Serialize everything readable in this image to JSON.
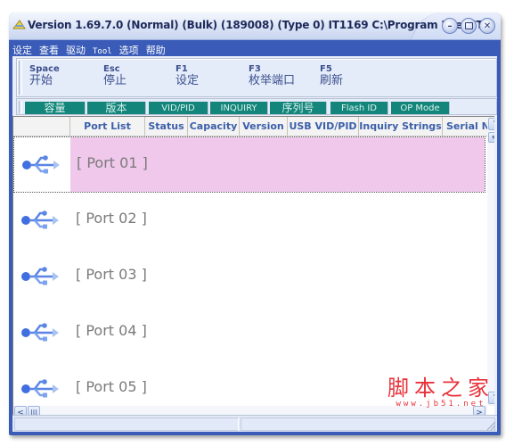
{
  "window": {
    "title": "Version 1.69.7.0 (Normal) (Bulk) (189008) (Type 0) IT1169 C:\\Program Files\\IT...",
    "controls": [
      "minimize",
      "restore",
      "close"
    ]
  },
  "menu": {
    "items": [
      {
        "label": "设定"
      },
      {
        "label": "查看"
      },
      {
        "label": "驱动"
      },
      {
        "label": "Tool"
      },
      {
        "label": "选项"
      },
      {
        "label": "帮助"
      }
    ]
  },
  "shortcuts": [
    {
      "key": "Space",
      "label": "开始"
    },
    {
      "key": "Esc",
      "label": "停止"
    },
    {
      "key": "F1",
      "label": "设定"
    },
    {
      "key": "F3",
      "label": "枚举端口"
    },
    {
      "key": "F5",
      "label": "刷新"
    }
  ],
  "tabs": [
    {
      "label": "容量"
    },
    {
      "label": "版本"
    },
    {
      "label": "VID/PID"
    },
    {
      "label": "INQUIRY"
    },
    {
      "label": "序列号"
    },
    {
      "label": "Flash ID"
    },
    {
      "label": "OP Mode"
    }
  ],
  "table": {
    "columns": [
      {
        "label": ""
      },
      {
        "label": "Port List"
      },
      {
        "label": "Status"
      },
      {
        "label": "Capacity"
      },
      {
        "label": "Version"
      },
      {
        "label": "USB VID/PID"
      },
      {
        "label": "Inquiry Strings"
      },
      {
        "label": "Serial Nu"
      }
    ],
    "rows": [
      {
        "icon": "usb-icon",
        "port": "[ Port 01 ]",
        "selected": true
      },
      {
        "icon": "usb-icon",
        "port": "[ Port 02 ]",
        "selected": false
      },
      {
        "icon": "usb-icon",
        "port": "[ Port 03 ]",
        "selected": false
      },
      {
        "icon": "usb-icon",
        "port": "[ Port 04 ]",
        "selected": false
      },
      {
        "icon": "usb-icon",
        "port": "[ Port 05 ]",
        "selected": false
      }
    ]
  },
  "scrollbars": {
    "up": "˄",
    "down": "˅",
    "left": "<",
    "right": ">"
  },
  "watermark": {
    "text": "脚本之家",
    "url": "www.jb51.net"
  },
  "colors": {
    "titlebar_accent": "#3a5cb8",
    "tab_bg": "#13857a",
    "selected_row": "#f0c8ec",
    "header_text": "#3b5faa",
    "watermark": "#e8323a"
  }
}
